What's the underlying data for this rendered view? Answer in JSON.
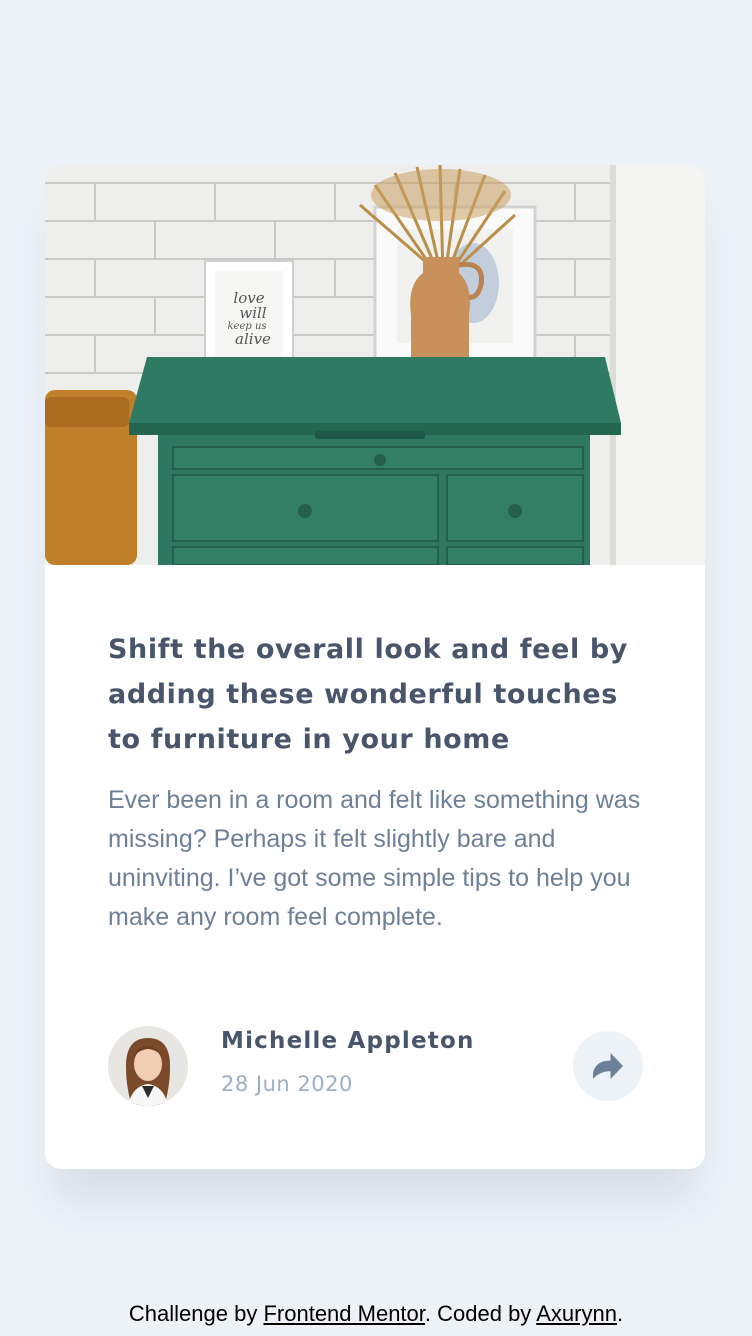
{
  "card": {
    "image_alt": "Green drawer with a vase and framed print",
    "title": "Shift the overall look and feel by adding these wonderful touches to furniture in your home",
    "description": "Ever been in a room and felt like something was missing? Perhaps it felt slightly bare and uninviting. I’ve got some simple tips to help you make any room feel complete.",
    "author": {
      "name": "Michelle Appleton",
      "date": "28 Jun 2020",
      "avatar_icon": "avatar-photo"
    },
    "share": {
      "icon": "share-arrow-icon"
    }
  },
  "footer": {
    "prefix": "Challenge by ",
    "link1": "Frontend Mentor",
    "middle": ". Coded by ",
    "link2": "Axurynn",
    "suffix": "."
  },
  "colors": {
    "background": "#ecf2f8",
    "card": "#ffffff",
    "heading": "#48556a",
    "body_text": "#6e8098",
    "date": "#9eafc2",
    "share_bg": "#ecf2f8",
    "share_icon": "#6e8098"
  }
}
